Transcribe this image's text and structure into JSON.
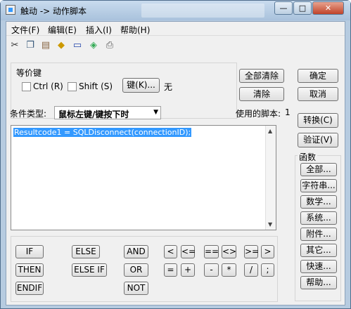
{
  "window": {
    "title": "触动 -> 动作脚本",
    "min_label": "—",
    "max_label": "□",
    "close_label": "✕"
  },
  "menu": [
    "文件(F)",
    "编辑(E)",
    "插入(I)",
    "帮助(H)"
  ],
  "toolbar": [
    "cut-icon",
    "copy-icon",
    "paste-icon",
    "tag-icon",
    "frame-icon",
    "object-icon",
    "print-icon"
  ],
  "equiv_key": {
    "title": "等价键",
    "ctrl": "Ctrl (R)",
    "shift": "Shift (S)",
    "key_button": "键(K)...",
    "key_value": "无"
  },
  "actions": {
    "clear_all": "全部清除",
    "clear": "清除",
    "ok": "确定",
    "cancel": "取消",
    "convert": "转换(C)",
    "verify": "验证(V)"
  },
  "condition": {
    "label": "条件类型:",
    "value": "鼠标左键/键按下时",
    "script_label": "使用的脚本:",
    "script_count": "1"
  },
  "script": {
    "code": "Resultcode1 = SQLDisconnect(connectionID);"
  },
  "operators": {
    "if": "IF",
    "else": "ELSE",
    "and": "AND",
    "then": "THEN",
    "elseif": "ELSE IF",
    "or": "OR",
    "endif": "ENDIF",
    "not": "NOT",
    "lt": "<",
    "le": "<=",
    "eq": "==",
    "ne": "<>",
    "ge": ">=",
    "gt": ">",
    "assign": "=",
    "plus": "+",
    "minus": "-",
    "mul": "*",
    "div": "/",
    "semi": ";"
  },
  "functions": {
    "title": "函数",
    "items": [
      "全部...",
      "字符串...",
      "数学...",
      "系统...",
      "附件...",
      "其它...",
      "快速...",
      "帮助..."
    ]
  }
}
